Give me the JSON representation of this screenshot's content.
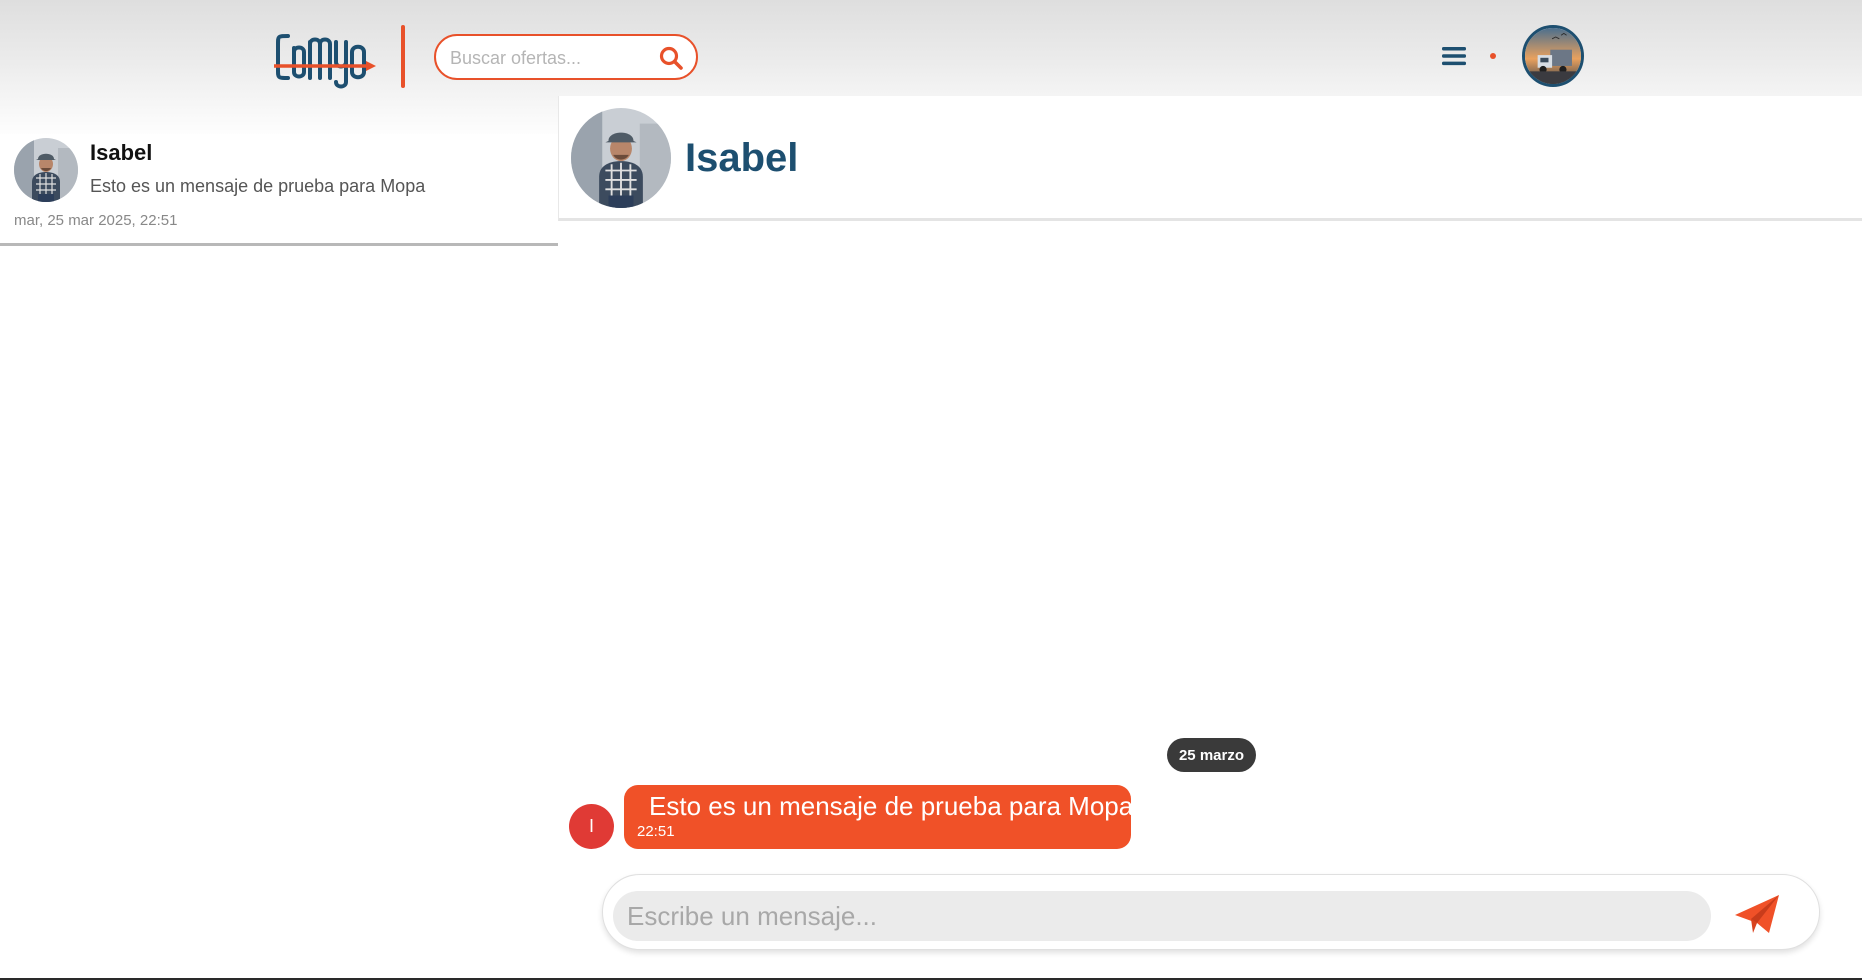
{
  "header": {
    "logo_text": "camyo",
    "search": {
      "placeholder": "Buscar ofertas...",
      "value": ""
    },
    "icons": {
      "search": "search-icon",
      "menu": "hamburger-menu-icon",
      "notification": "notification-dot"
    }
  },
  "conversations": [
    {
      "name": "Isabel",
      "preview": "Esto es un mensaje de prueba para Mopa",
      "timestamp": "mar, 25 mar 2025, 22:51"
    }
  ],
  "chat": {
    "contact_name": "Isabel",
    "date_separator": "25 marzo",
    "messages": [
      {
        "sender_initial": "I",
        "text": "Esto es un mensaje de prueba para Mopa",
        "time": "22:51"
      }
    ],
    "composer": {
      "placeholder": "Escribe un mensaje...",
      "value": ""
    }
  },
  "colors": {
    "accent": "#f05128",
    "brand_blue": "#1d4f70",
    "date_pill": "#3a3a3a",
    "sender_badge": "#e03a35"
  }
}
